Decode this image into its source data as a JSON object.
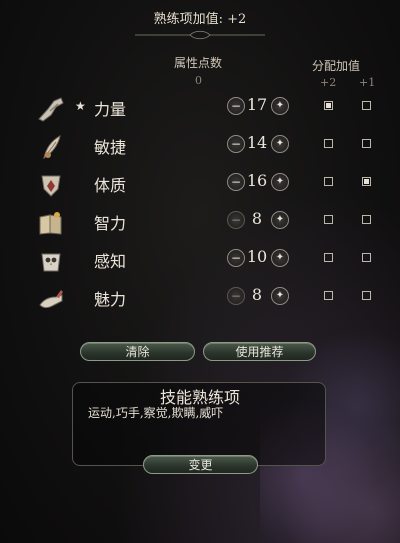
{
  "header": {
    "proficiency_title": "熟练项加值: +2"
  },
  "columns": {
    "points_label": "属性点数",
    "points_remaining": "0",
    "bonus_label": "分配加值",
    "bonus_plus2": "+2",
    "bonus_plus1": "+1"
  },
  "attributes": [
    {
      "star": "★",
      "name": "力量",
      "value": "17",
      "icon": "strength-arm-icon",
      "plus2": true,
      "plus1": false,
      "minus_enabled": true,
      "plus_enabled": true
    },
    {
      "star": "",
      "name": "敏捷",
      "value": "14",
      "icon": "dexterity-feather-icon",
      "plus2": false,
      "plus1": false,
      "minus_enabled": true,
      "plus_enabled": true
    },
    {
      "star": "",
      "name": "体质",
      "value": "16",
      "icon": "constitution-shield-icon",
      "plus2": false,
      "plus1": true,
      "minus_enabled": true,
      "plus_enabled": true
    },
    {
      "star": "",
      "name": "智力",
      "value": "8",
      "icon": "intelligence-book-icon",
      "plus2": false,
      "plus1": false,
      "minus_enabled": false,
      "plus_enabled": true
    },
    {
      "star": "",
      "name": "感知",
      "value": "10",
      "icon": "wisdom-owl-icon",
      "plus2": false,
      "plus1": false,
      "minus_enabled": true,
      "plus_enabled": true
    },
    {
      "star": "",
      "name": "魅力",
      "value": "8",
      "icon": "charisma-hand-icon",
      "plus2": false,
      "plus1": false,
      "minus_enabled": false,
      "plus_enabled": true
    }
  ],
  "buttons": {
    "clear": "清除",
    "recommend": "使用推荐",
    "change": "变更"
  },
  "skills": {
    "title": "技能熟练项",
    "list": "运动,巧手,察觉,欺瞒,威吓"
  },
  "colors": {
    "accent_green": "#4b5a4b",
    "text": "#ece6da"
  }
}
